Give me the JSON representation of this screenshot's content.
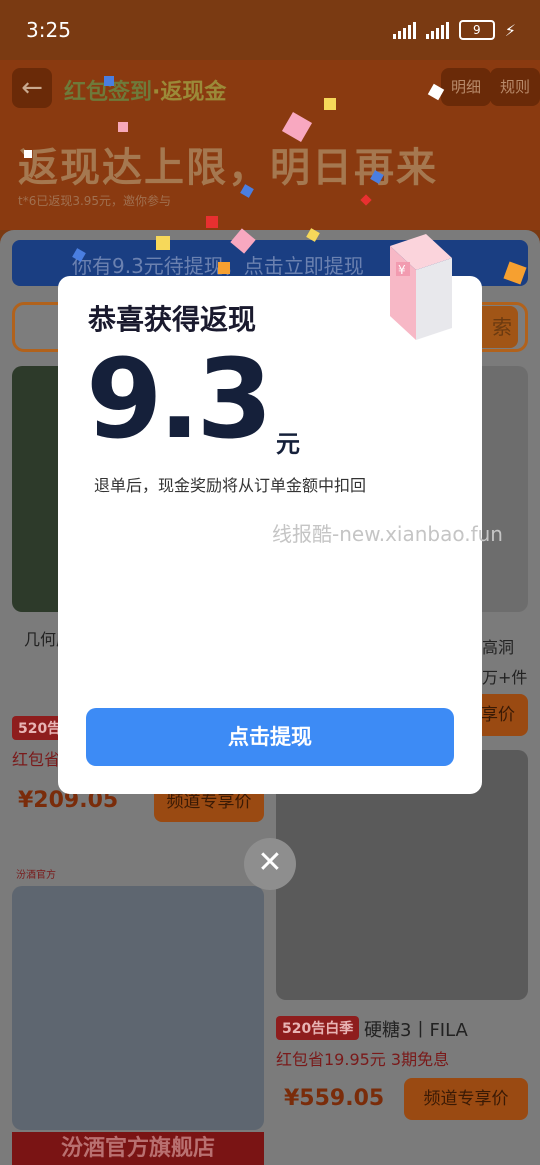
{
  "status_bar": {
    "time": "3:25",
    "battery": "9"
  },
  "header": {
    "back_icon": "arrow-left-icon",
    "title_main": "红包签到",
    "title_sep": "·",
    "title_accent": "返现金",
    "detail_label": "明细",
    "rules_label": "规则",
    "headline": "返现达上限，明日再来",
    "subline": "t*6已返现3.95元，邀你参与"
  },
  "banner": {
    "text": "你有9.3元待提现，点击立即提现"
  },
  "search": {
    "button_label": "索"
  },
  "feed": {
    "card1": {
      "title": "几何底",
      "tag": "520告",
      "subtitle": "红包省",
      "price": "¥209.05",
      "deal_label": "频道专享价"
    },
    "card2": {
      "title_right": "高洞",
      "sales": "万+件",
      "deal_label": "享价"
    },
    "card3": {
      "brand": "汾酒官方",
      "footer": "汾酒官方旗舰店"
    },
    "card4": {
      "tag": "520告白季",
      "title": "硬糖3丨FILA",
      "subtitle": "红包省19.95元 3期免息",
      "price": "¥559.05",
      "deal_label": "频道专享价"
    }
  },
  "modal": {
    "title": "恭喜获得返现",
    "amount": "9.3",
    "unit": "元",
    "note": "退单后，现金奖励将从订单金额中扣回",
    "watermark": "线报酷-new.xianbao.fun",
    "button_label": "点击提现"
  },
  "close_icon": "close-icon",
  "colors": {
    "primary_button": "#3d8bf5",
    "amount_text": "#15203a",
    "modal_bg": "#ffffff"
  }
}
